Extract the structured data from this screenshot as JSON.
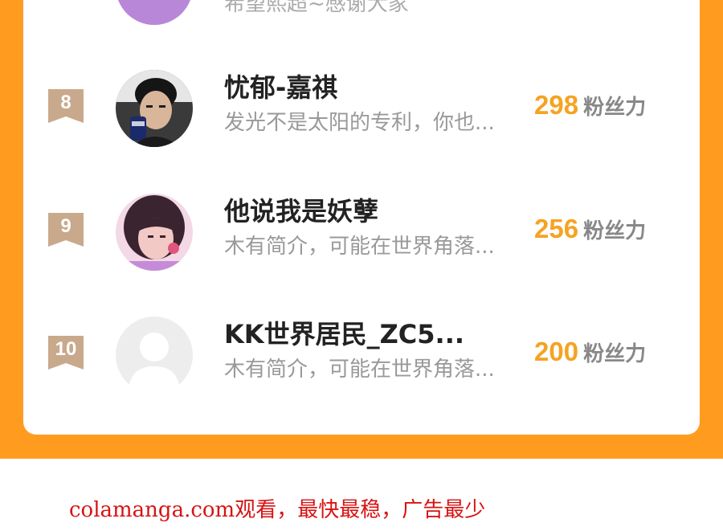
{
  "previous_entry": {
    "bio": "希望熙超~感谢大家"
  },
  "fans_unit_label": "粉丝力",
  "ranking": [
    {
      "rank": "8",
      "name": "忧郁-嘉祺",
      "bio": "发光不是太阳的专利，你也...",
      "fans": "298",
      "avatar": "photo-avatar-boy"
    },
    {
      "rank": "9",
      "name": "他说我是妖孽",
      "bio": "木有简介，可能在世界角落...",
      "fans": "256",
      "avatar": "photo-avatar-girl"
    },
    {
      "rank": "10",
      "name": "KK世界居民_ZC5...",
      "bio": "木有简介，可能在世界角落...",
      "fans": "200",
      "avatar": "default-avatar"
    }
  ],
  "footer": {
    "text": "colamanga.com观看，最快最稳，广告最少"
  },
  "colors": {
    "panel_background": "#FF9C20",
    "badge": "#C9A98C",
    "fans_count": "#F5A323",
    "footer_text": "#D71313"
  }
}
